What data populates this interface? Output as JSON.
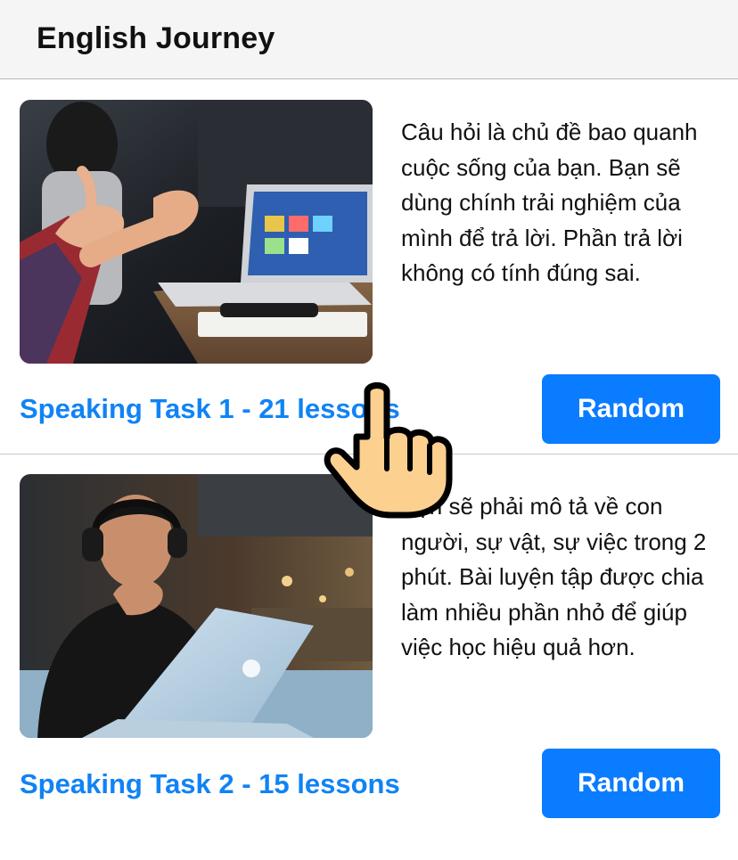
{
  "header": {
    "title": "English Journey"
  },
  "cards": [
    {
      "image": "photo-meeting-laptop",
      "description": "Câu hỏi là chủ đề bao quanh cuộc sống của bạn. Bạn sẽ dùng chính trải nghiệm của mình để trả lời. Phần trả lời không có tính đúng sai.",
      "title": "Speaking Task 1 - 21 lessons",
      "button_label": "Random"
    },
    {
      "image": "photo-man-headphones-laptop",
      "description": "Bạn sẽ phải mô tả về con người, sự vật, sự việc trong 2 phút. Bài luyện tập được chia làm nhiều phần nhỏ để giúp việc học hiệu quả hơn.",
      "title": "Speaking Task 2 - 15 lessons",
      "button_label": "Random"
    }
  ],
  "cursor": {
    "icon": "hand-pointer-icon"
  },
  "colors": {
    "accent": "#0a7cff",
    "link": "#1083f5",
    "header_bg": "#f5f5f5"
  }
}
